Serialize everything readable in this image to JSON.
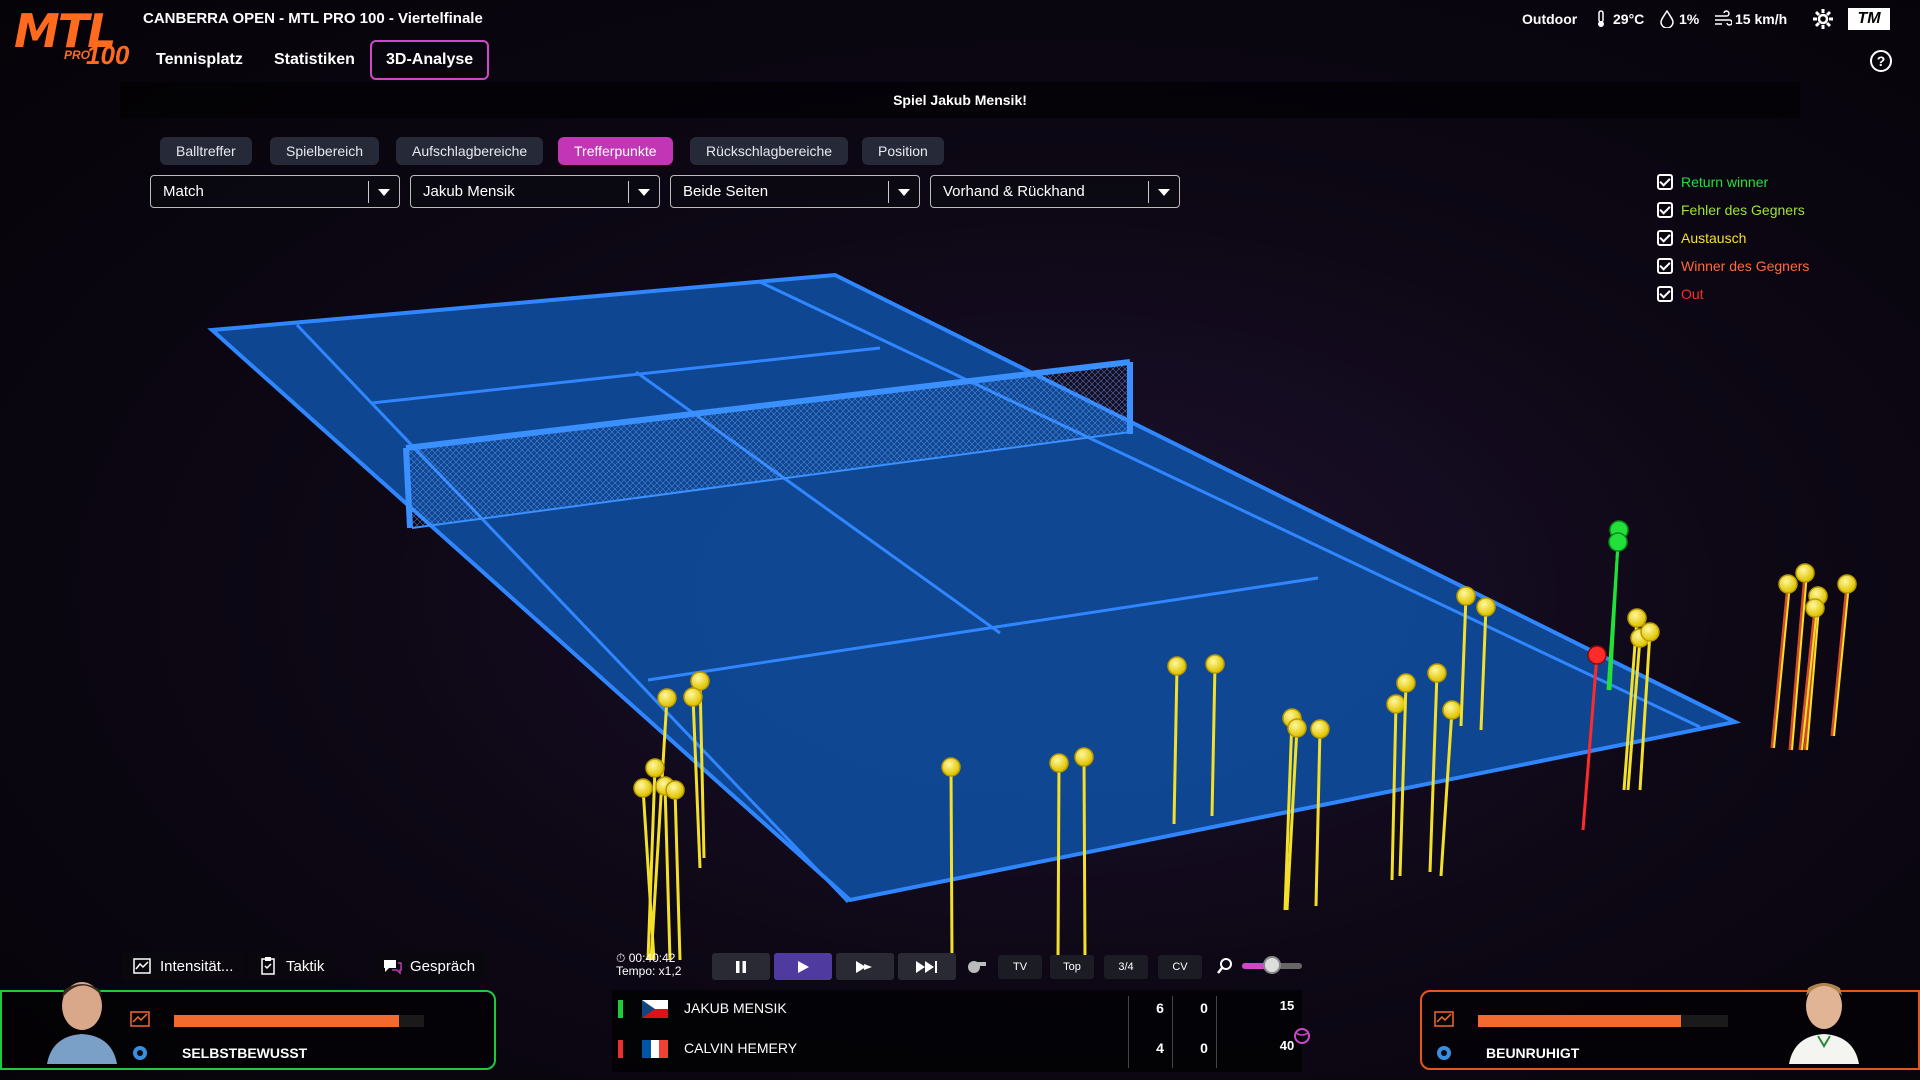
{
  "header": {
    "logo": {
      "brand": "MTL",
      "tier": "PRO",
      "number": "100"
    },
    "event_title": "CANBERRA OPEN - MTL PRO 100 - Viertelfinale",
    "nav_tabs": [
      {
        "label": "Tennisplatz",
        "active": false
      },
      {
        "label": "Statistiken",
        "active": false
      },
      {
        "label": "3D-Analyse",
        "active": true
      }
    ],
    "weather": {
      "venue": "Outdoor",
      "temperature": "29°C",
      "humidity": "1%",
      "wind": "15 km/h"
    },
    "badge": "TM"
  },
  "message": "Spiel Jakub Mensik!",
  "analysis_tabs": [
    {
      "label": "Balltreffer",
      "active": false
    },
    {
      "label": "Spielbereich",
      "active": false
    },
    {
      "label": "Aufschlagbereiche",
      "active": false
    },
    {
      "label": "Trefferpunkte",
      "active": true
    },
    {
      "label": "Rückschlagbereiche",
      "active": false
    },
    {
      "label": "Position",
      "active": false
    }
  ],
  "filters": [
    {
      "value": "Match"
    },
    {
      "value": "Jakub Mensik"
    },
    {
      "value": "Beide Seiten"
    },
    {
      "value": "Vorhand & Rückhand"
    }
  ],
  "legend": [
    {
      "label": "Return winner",
      "color": "#22e03a",
      "checked": true
    },
    {
      "label": "Fehler des Gegners",
      "color": "#9fe23a",
      "checked": true
    },
    {
      "label": "Austausch",
      "color": "#f3e02a",
      "checked": true
    },
    {
      "label": "Winner des Gegners",
      "color": "#ff6a3a",
      "checked": true
    },
    {
      "label": "Out",
      "color": "#ff2a2a",
      "checked": true
    }
  ],
  "actions": {
    "intensity": "Intensität...",
    "tactics": "Taktik",
    "talk": "Gespräch"
  },
  "left_player": {
    "confidence_level": 0.9,
    "mood": "SELBSTBEWUSST",
    "accent": "#1ec93c"
  },
  "right_player": {
    "confidence_level": 0.81,
    "mood": "BEUNRUHIGT",
    "accent": "#e8541c"
  },
  "playback": {
    "time": "00:40:42",
    "tempo": "Tempo: x1,2",
    "camera_views": [
      "TV",
      "Top",
      "3/4",
      "CV"
    ],
    "zoom_level": 0.5
  },
  "scoreboard": {
    "players": [
      {
        "name": "JAKUB MENSIK",
        "flag": "Czech Republic",
        "status_color": "#1ec93c",
        "sets": [
          "6",
          "0"
        ],
        "points": "15"
      },
      {
        "name": "CALVIN HEMERY",
        "flag": "France",
        "status_color": "#e83030",
        "sets": [
          "4",
          "0"
        ],
        "points": "40"
      }
    ]
  },
  "palette": {
    "court": "#0f4c9c",
    "lines": "#2f86ff",
    "accent": "#d048c8",
    "brand": "#ff6a1f"
  }
}
